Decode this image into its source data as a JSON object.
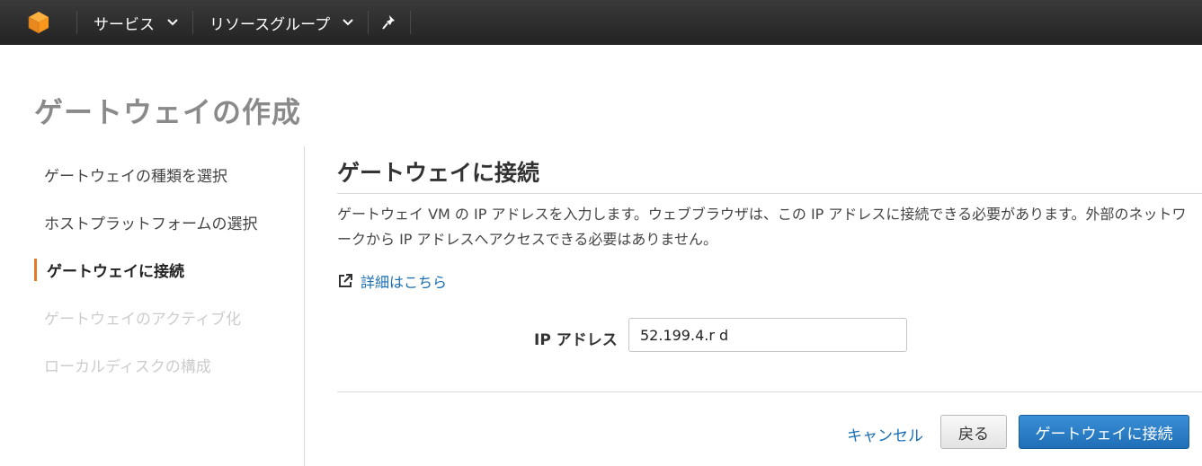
{
  "topbar": {
    "logo_icon": "aws-cube-icon",
    "services_label": "サービス",
    "resource_groups_label": "リソースグループ",
    "pin_icon": "pin-icon",
    "brand_color": "#f7981d"
  },
  "page": {
    "title": "ゲートウェイの作成"
  },
  "steps": [
    {
      "label": "ゲートウェイの種類を選択",
      "state": "normal"
    },
    {
      "label": "ホストプラットフォームの選択",
      "state": "normal"
    },
    {
      "label": "ゲートウェイに接続",
      "state": "active"
    },
    {
      "label": "ゲートウェイのアクティブ化",
      "state": "disabled"
    },
    {
      "label": "ローカルディスクの構成",
      "state": "disabled"
    }
  ],
  "panel": {
    "title": "ゲートウェイに接続",
    "description": "ゲートウェイ VM の IP アドレスを入力します。ウェブブラウザは、この IP アドレスに接続できる必要があります。外部のネットワークから IP アドレスへアクセスできる必要はありません。",
    "more_link": "詳細はこちら",
    "ip_label": "IP アドレス",
    "ip_value": "52.199.4.r d"
  },
  "actions": {
    "cancel": "キャンセル",
    "back": "戻る",
    "connect": "ゲートウェイに接続"
  },
  "colors": {
    "accent_orange": "#e07b28",
    "link_blue": "#1a6fb3",
    "primary_button": "#1f6fb7"
  }
}
